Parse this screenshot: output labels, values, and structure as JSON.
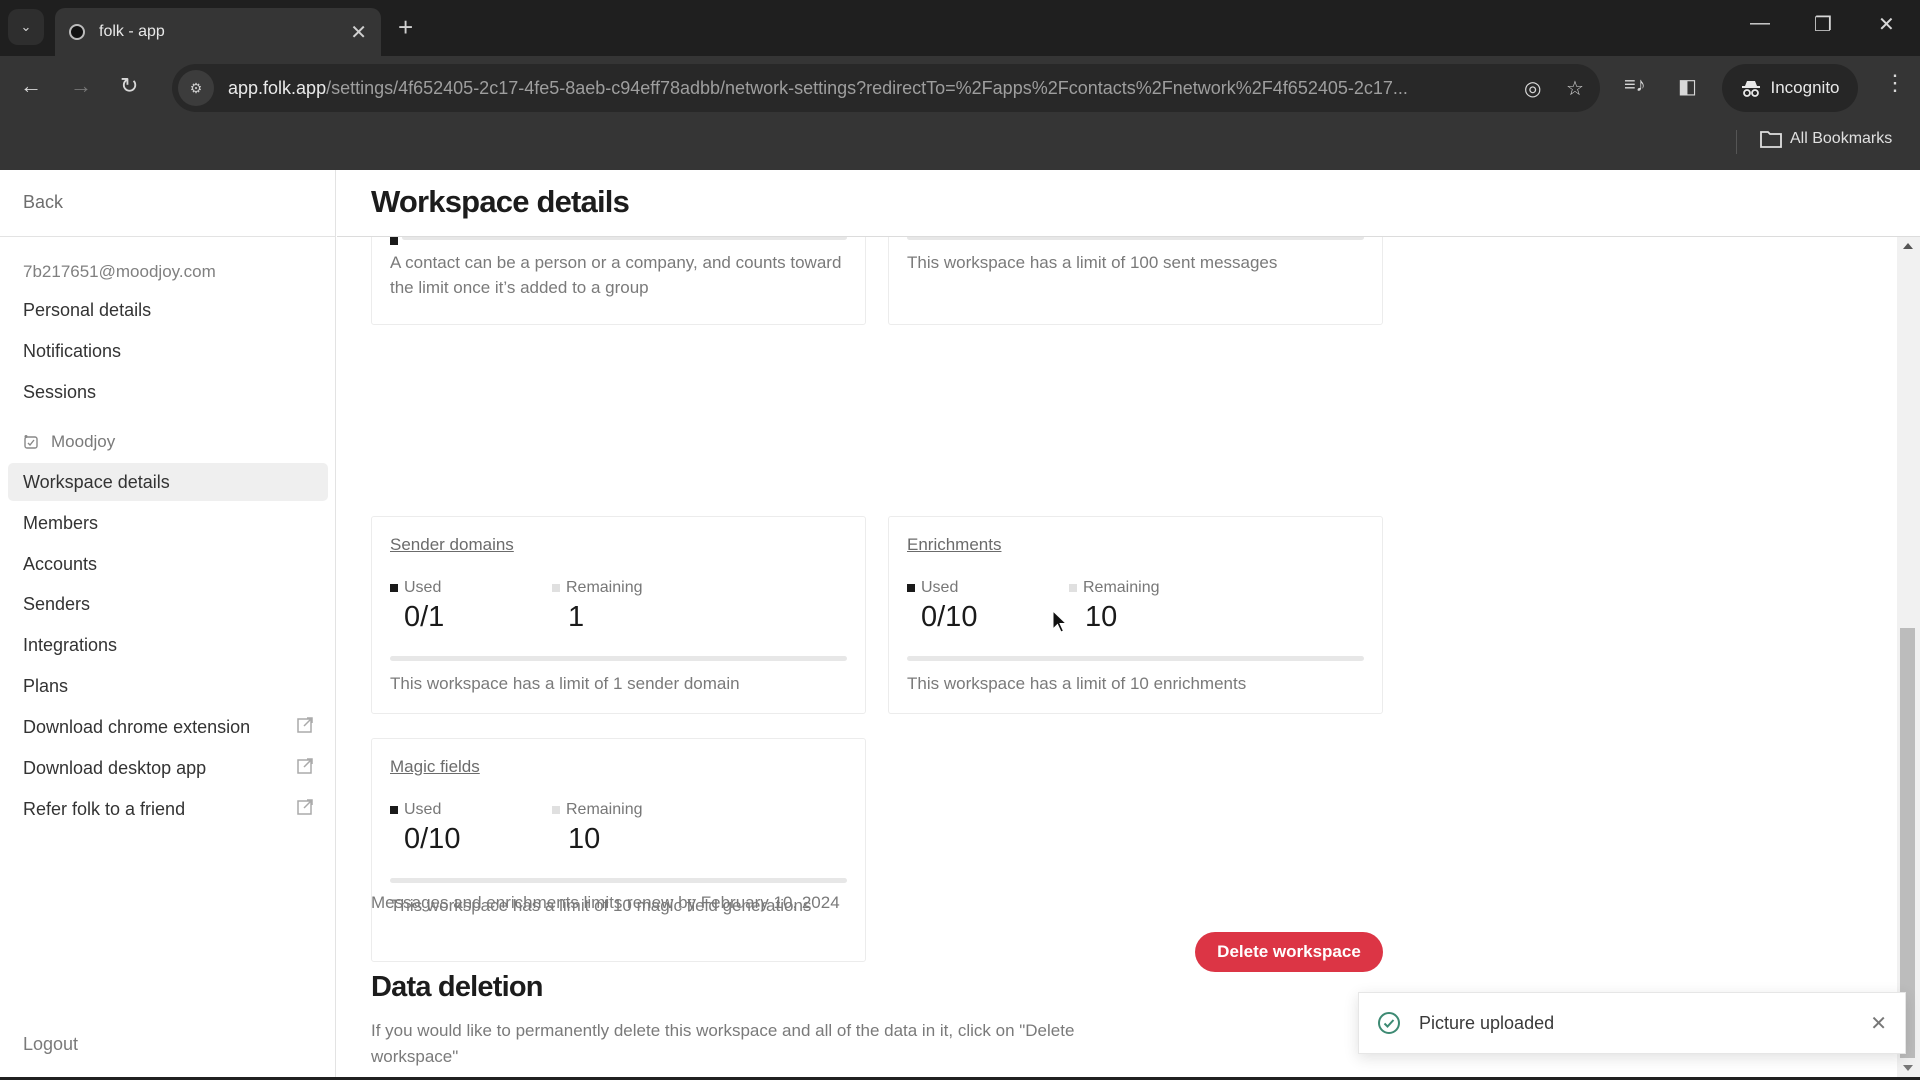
{
  "browser": {
    "tab_title": "folk - app",
    "url_host": "app.folk.app",
    "url_path": "/settings/4f652405-2c17-4fe5-8aeb-c94eff78adbb/network-settings?redirectTo=%2Fapps%2Fcontacts%2Fnetwork%2F4f652405-2c17...",
    "incognito_label": "Incognito",
    "all_bookmarks_label": "All Bookmarks",
    "icons": {
      "tab_dropdown": "⌄",
      "tab_close": "✕",
      "new_tab": "+",
      "minimize": "—",
      "restore": "❐",
      "close": "✕",
      "back": "←",
      "forward": "→",
      "reload": "↻",
      "site_info": "⚙",
      "eye_off": "◎",
      "star": "☆",
      "media": "≡♪",
      "sidepanel": "◧",
      "kebab": "⋮"
    }
  },
  "sidebar": {
    "back_label": "Back",
    "email": "7b217651@moodjoy.com",
    "personal_items": [
      {
        "label": "Personal details"
      },
      {
        "label": "Notifications"
      },
      {
        "label": "Sessions"
      }
    ],
    "workspace_name": "Moodjoy",
    "workspace_items": [
      {
        "label": "Workspace details",
        "active": true
      },
      {
        "label": "Members"
      },
      {
        "label": "Accounts"
      },
      {
        "label": "Senders"
      },
      {
        "label": "Integrations"
      },
      {
        "label": "Plans"
      },
      {
        "label": "Download chrome extension",
        "external": true
      },
      {
        "label": "Download desktop app",
        "external": true
      },
      {
        "label": "Refer folk to a friend",
        "external": true
      }
    ],
    "logout_label": "Logout"
  },
  "header": {
    "title": "Workspace details"
  },
  "cards": {
    "contacts_partial": {
      "description": "A contact can be a person or a company, and counts toward the limit once it’s added to a group"
    },
    "messages_partial": {
      "description": "This workspace has a limit of 100 sent messages"
    },
    "sender_domains": {
      "title": "Sender domains",
      "used_label": "Used",
      "remaining_label": "Remaining",
      "used_value": "0/1",
      "remaining_value": "1",
      "used_fraction": 0,
      "description": "This workspace has a limit of 1 sender domain"
    },
    "enrichments": {
      "title": "Enrichments",
      "used_label": "Used",
      "remaining_label": "Remaining",
      "used_value": "0/10",
      "remaining_value": "10",
      "used_fraction": 0,
      "description": "This workspace has a limit of 10 enrichments"
    },
    "magic_fields": {
      "title": "Magic fields",
      "used_label": "Used",
      "remaining_label": "Remaining",
      "used_value": "0/10",
      "remaining_value": "10",
      "used_fraction": 0,
      "description": "This workspace has a limit of 10 magic field generations"
    }
  },
  "renew_text": "Messages and enrichments limits renew by February 10, 2024",
  "data_deletion": {
    "title": "Data deletion",
    "description": "If you would like to permanently delete this workspace and all of the data in it, click on \"Delete workspace\"",
    "button_label": "Delete workspace",
    "button_color": "#dc3545"
  },
  "toast": {
    "message": "Picture uploaded",
    "icon_color": "#3d8a73"
  }
}
